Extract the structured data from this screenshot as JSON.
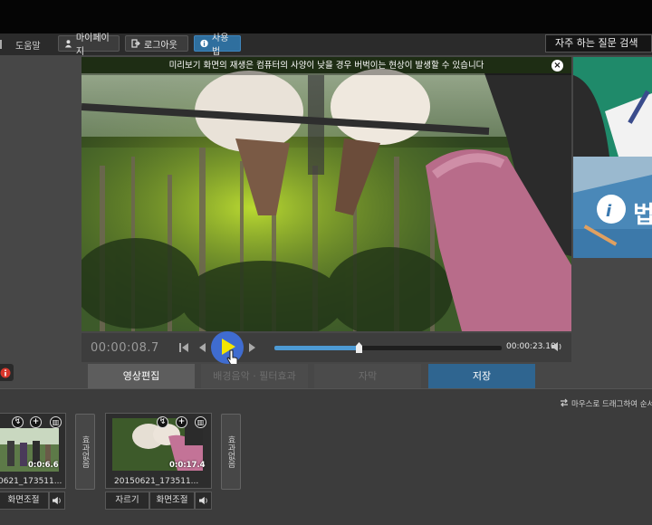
{
  "menubar": {
    "help": "도움말",
    "mypage": "마이페이지",
    "logout": "로그아웃",
    "howto": "사용법",
    "faq": "자주 하는 질문 검색"
  },
  "preview": {
    "notice": "미리보기 화면의 재생은 컴퓨터의 사양이 낮을 경우 버벅이는 현상이 발생할 수 있습니다",
    "close": "×"
  },
  "banner": {
    "icon_letter": "i",
    "text": "법"
  },
  "player": {
    "current_time": "00:00:08.7",
    "end_time": "00:00:23.10",
    "progress": 0.37
  },
  "tabs": [
    {
      "label": "영상편집"
    },
    {
      "label": "배경음악 · 필터효과"
    },
    {
      "label": "자막"
    },
    {
      "label": "저장"
    }
  ],
  "timeline": {
    "hint": "마우스로 드래그하여 순서를",
    "clips": [
      {
        "title": "0621_173511...",
        "duration": "0:0:6.6",
        "buttons": [
          "화면조절"
        ]
      },
      {
        "title": "20150621_173511...",
        "duration": "0:0:17.4",
        "buttons": [
          "자르기",
          "화면조절"
        ]
      }
    ],
    "effect_label": "효과없음"
  },
  "icons": {
    "user": "user-icon",
    "logout": "logout-icon",
    "info": "info-icon",
    "play": "play-icon",
    "skip_start": "skip-to-start-icon",
    "step_back": "step-back-icon",
    "step_forward": "step-forward-icon",
    "volume": "volume-icon",
    "close": "close-icon",
    "swap": "swap-arrows-icon"
  },
  "colors": {
    "accent_blue": "#2f6590",
    "seek_fill": "#4d9ad4",
    "play_yellow": "#f4e500",
    "cursor_blue": "#3f6fd8"
  }
}
